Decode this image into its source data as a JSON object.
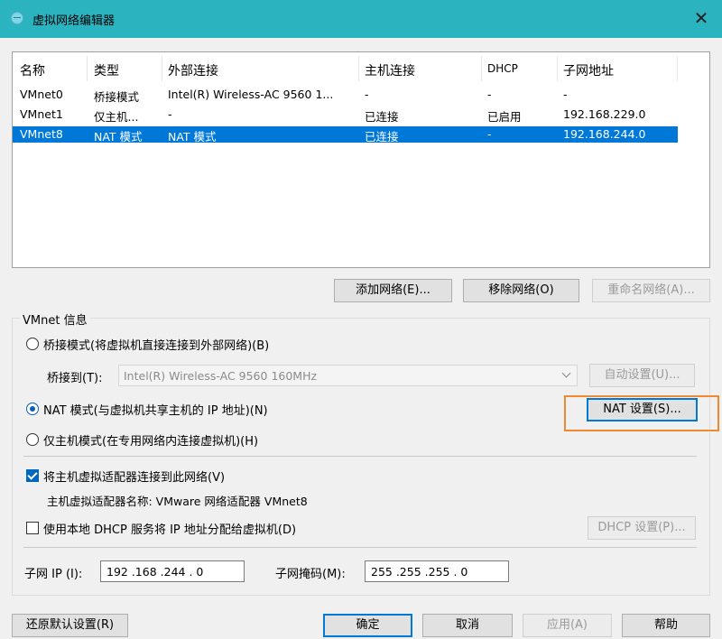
{
  "window": {
    "title": "虚拟网络编辑器",
    "close_glyph": "✕"
  },
  "table": {
    "columns": [
      "名称",
      "类型",
      "外部连接",
      "主机连接",
      "DHCP",
      "子网地址"
    ],
    "rows": [
      [
        "VMnet0",
        "桥接模式",
        "Intel(R) Wireless-AC 9560 1...",
        "-",
        "-",
        "-"
      ],
      [
        "VMnet1",
        "仅主机...",
        "-",
        "已连接",
        "已启用",
        "192.168.229.0"
      ],
      [
        "VMnet8",
        "NAT 模式",
        "NAT 模式",
        "已连接",
        "-",
        "192.168.244.0"
      ]
    ],
    "selected_row": "VMnet8"
  },
  "list_buttons": {
    "add": "添加网络(E)...",
    "remove": "移除网络(O)",
    "rename": "重命名网络(A)..."
  },
  "vmnet_info": {
    "group_label": "VMnet 信息",
    "bridged_label": "桥接模式(将虚拟机直接连接到外部网络)(B)",
    "bridged_to_label": "桥接到(T):",
    "bridged_to_value": "Intel(R) Wireless-AC 9560 160MHz",
    "auto_settings": "自动设置(U)...",
    "nat_label": "NAT 模式(与虚拟机共享主机的 IP 地址)(N)",
    "nat_settings": "NAT 设置(S)...",
    "hostonly_label": "仅主机模式(在专用网络内连接虚拟机)(H)",
    "selected_mode": "nat",
    "connect_adapter_label": "将主机虚拟适配器连接到此网络(V)",
    "connect_adapter_checked": true,
    "adapter_name_text": "主机虚拟适配器名称: VMware 网络适配器 VMnet8",
    "dhcp_label": "使用本地 DHCP 服务将 IP 地址分配给虚拟机(D)",
    "dhcp_checked": false,
    "dhcp_settings": "DHCP 设置(P)...",
    "subnet_ip_label": "子网 IP (I):",
    "subnet_ip_value": "192 .168 .244 . 0",
    "subnet_mask_label": "子网掩码(M):",
    "subnet_mask_value": "255 .255 .255 . 0"
  },
  "footer": {
    "restore": "还原默认设置(R)",
    "ok": "确定",
    "cancel": "取消",
    "apply": "应用(A)",
    "help": "帮助"
  },
  "colors": {
    "titlebar": "#2bb3c0",
    "selection": "#0078d7",
    "highlight": "#f08a30"
  }
}
